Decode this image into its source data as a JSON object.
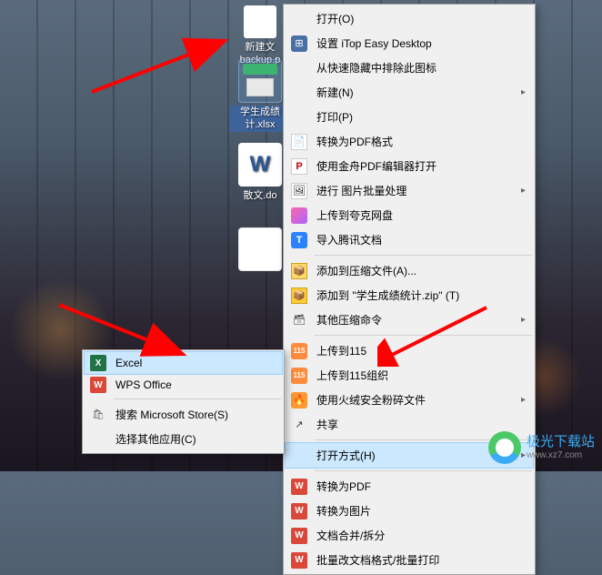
{
  "desktop": {
    "icons": [
      {
        "label": "新建文\nbackup.p"
      },
      {
        "label": "学生成绩\n计.xlsx"
      },
      {
        "label": "散文.do"
      },
      {
        "label": ""
      }
    ]
  },
  "main_menu": {
    "open": "打开(O)",
    "itop": "设置 iTop Easy Desktop",
    "exclude": "从快速隐藏中排除此图标",
    "new": "新建(N)",
    "print": "打印(P)",
    "to_pdf": "转换为PDF格式",
    "jinzhou_pdf": "使用金舟PDF编辑器打开",
    "batch_img": "进行 图片批量处理",
    "upload_kk": "上传到夸克网盘",
    "import_tencent": "导入腾讯文档",
    "add_zip_a": "添加到压缩文件(A)...",
    "add_zip_t": "添加到 \"学生成绩统计.zip\" (T)",
    "other_zip": "其他压缩命令",
    "upload_115": "上传到115",
    "upload_115_group": "上传到115组织",
    "huorong": "使用火绒安全粉碎文件",
    "share": "共享",
    "open_with": "打开方式(H)",
    "wps_to_pdf": "转换为PDF",
    "wps_to_img": "转换为图片",
    "wps_merge": "文档合并/拆分",
    "wps_batch": "批量改文档格式/批量打印"
  },
  "submenu": {
    "excel": "Excel",
    "wps": "WPS Office",
    "search_store": "搜索 Microsoft Store(S)",
    "choose_other": "选择其他应用(C)"
  },
  "watermark": {
    "name": "极光下载站",
    "url": "www.xz7.com"
  }
}
